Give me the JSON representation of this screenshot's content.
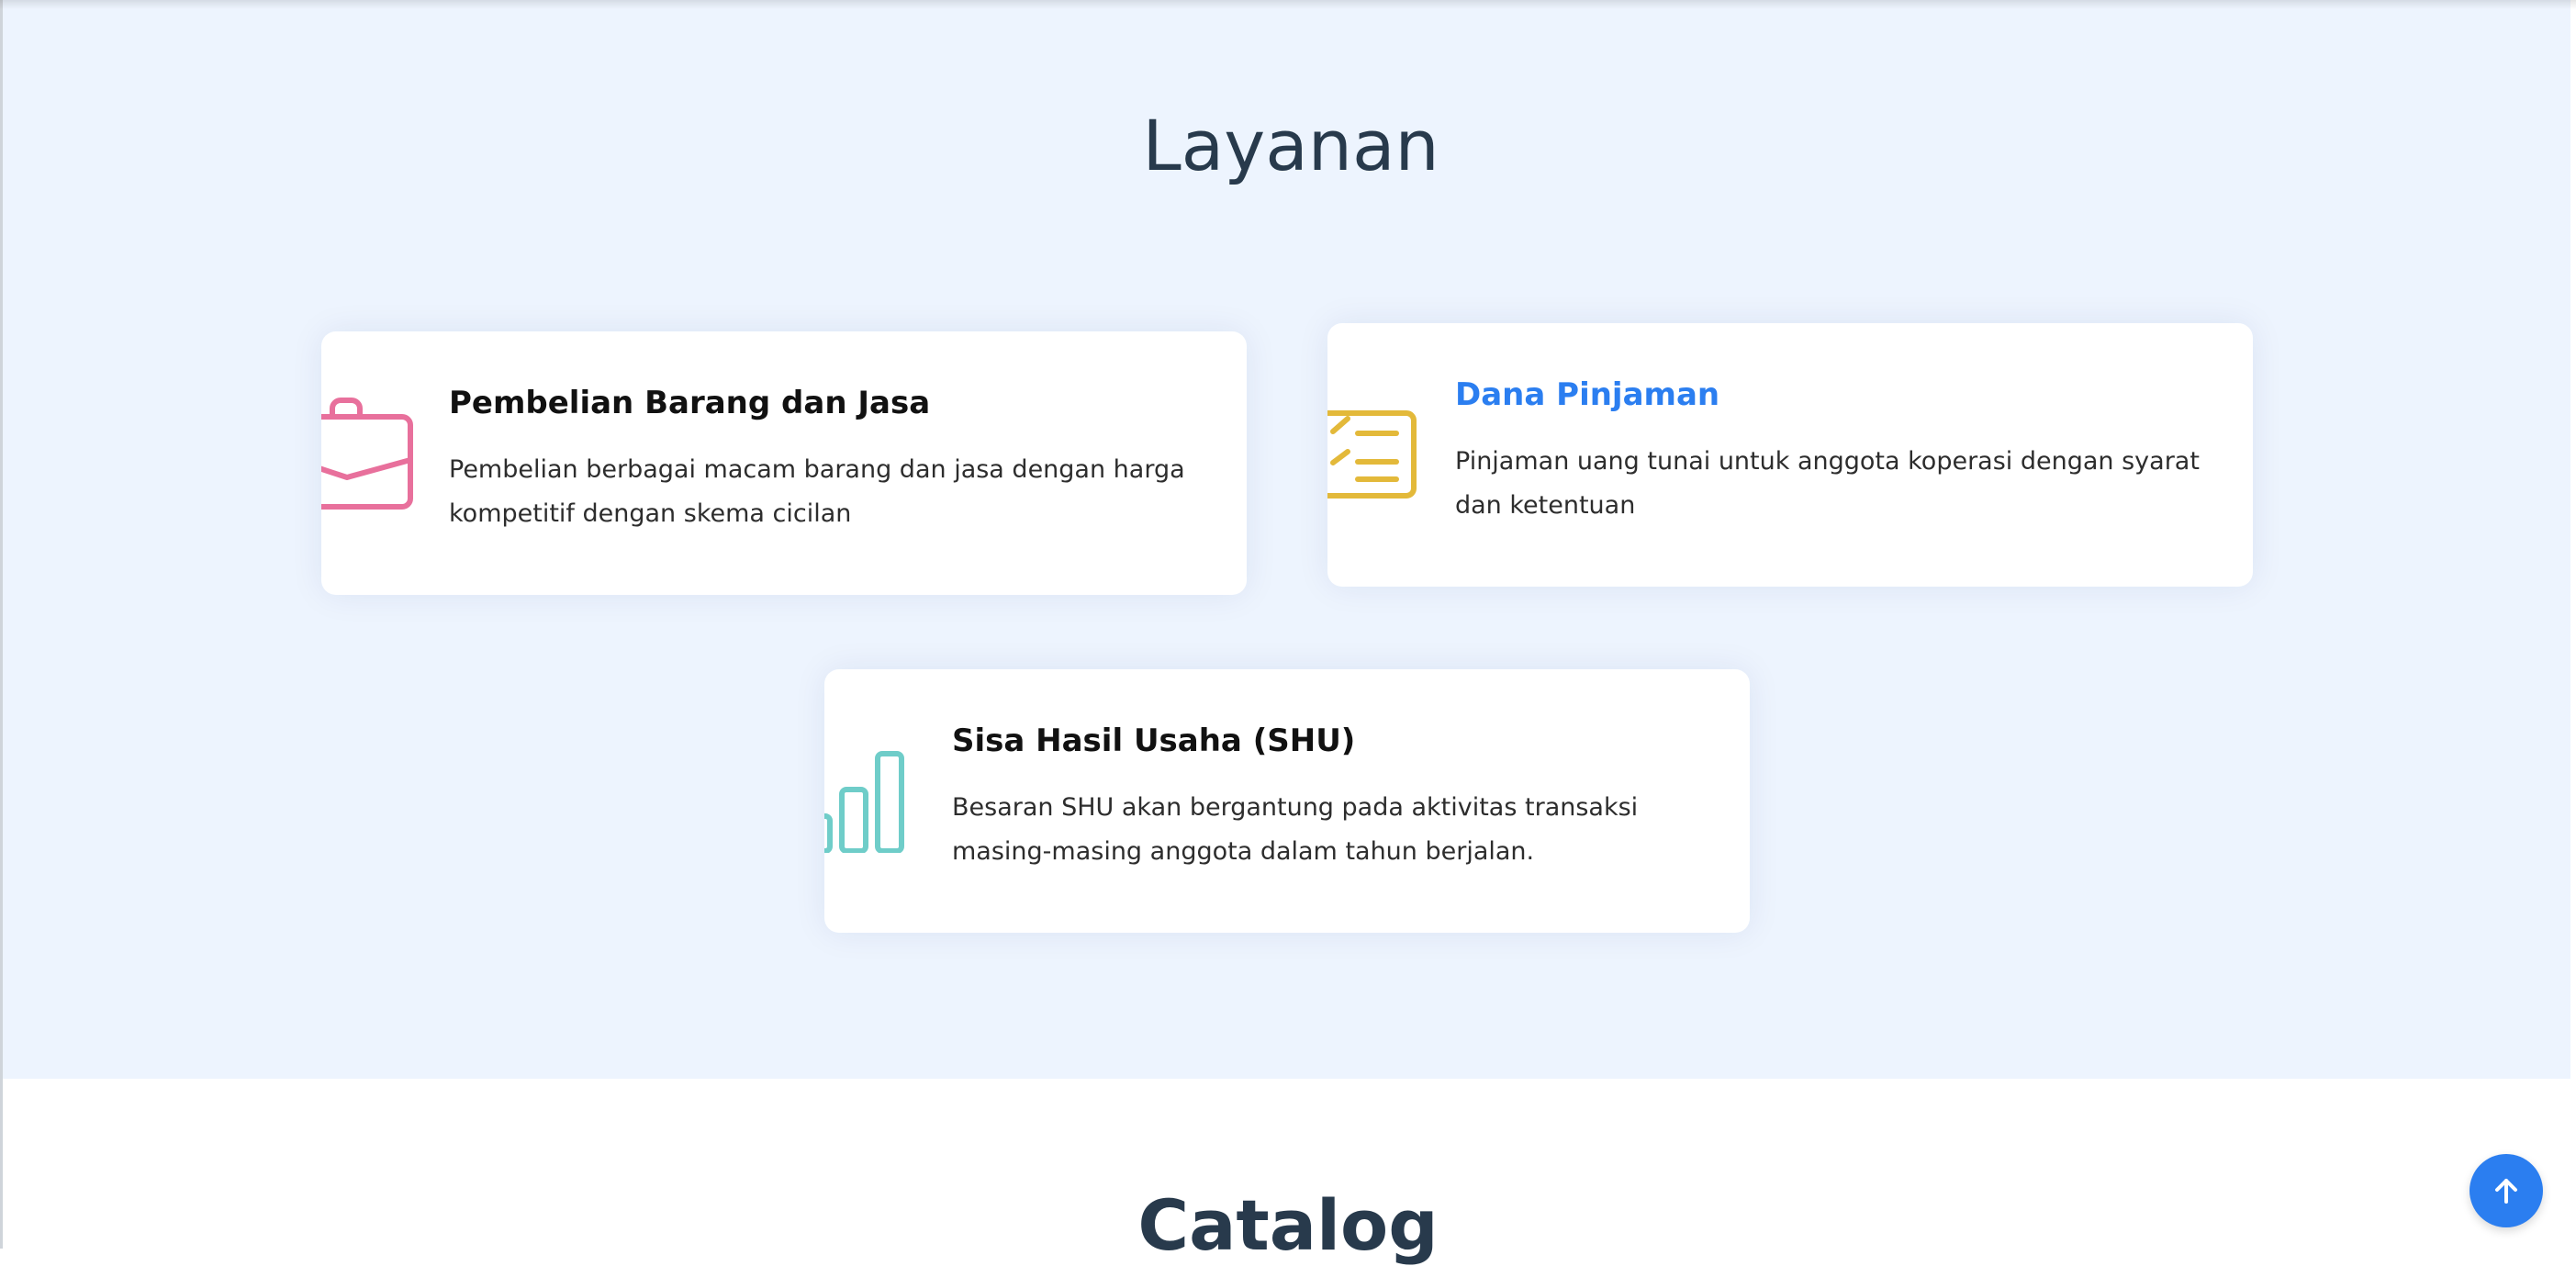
{
  "services": {
    "title": "Layanan",
    "items": [
      {
        "title": "Pembelian Barang dan Jasa",
        "description": "Pembelian berbagai macam barang dan jasa dengan harga kompetitif dengan skema cicilan",
        "icon": "briefcase-icon",
        "icon_color": "#e8709c",
        "title_color": "#111111"
      },
      {
        "title": "Dana Pinjaman",
        "description": "Pinjaman uang tunai untuk anggota koperasi dengan syarat dan ketentuan",
        "icon": "list-icon",
        "icon_color": "#e3b93a",
        "title_color": "#2b7ef0"
      },
      {
        "title": "Sisa Hasil Usaha (SHU)",
        "description": "Besaran SHU akan bergantung pada aktivitas transaksi masing-masing anggota dalam tahun berjalan.",
        "icon": "bar-chart-icon",
        "icon_color": "#6fcdc9",
        "title_color": "#111111"
      }
    ]
  },
  "catalog": {
    "title": "Catalog"
  },
  "back_to_top": {
    "icon": "arrow-up-icon",
    "color": "#2b7ef0"
  }
}
